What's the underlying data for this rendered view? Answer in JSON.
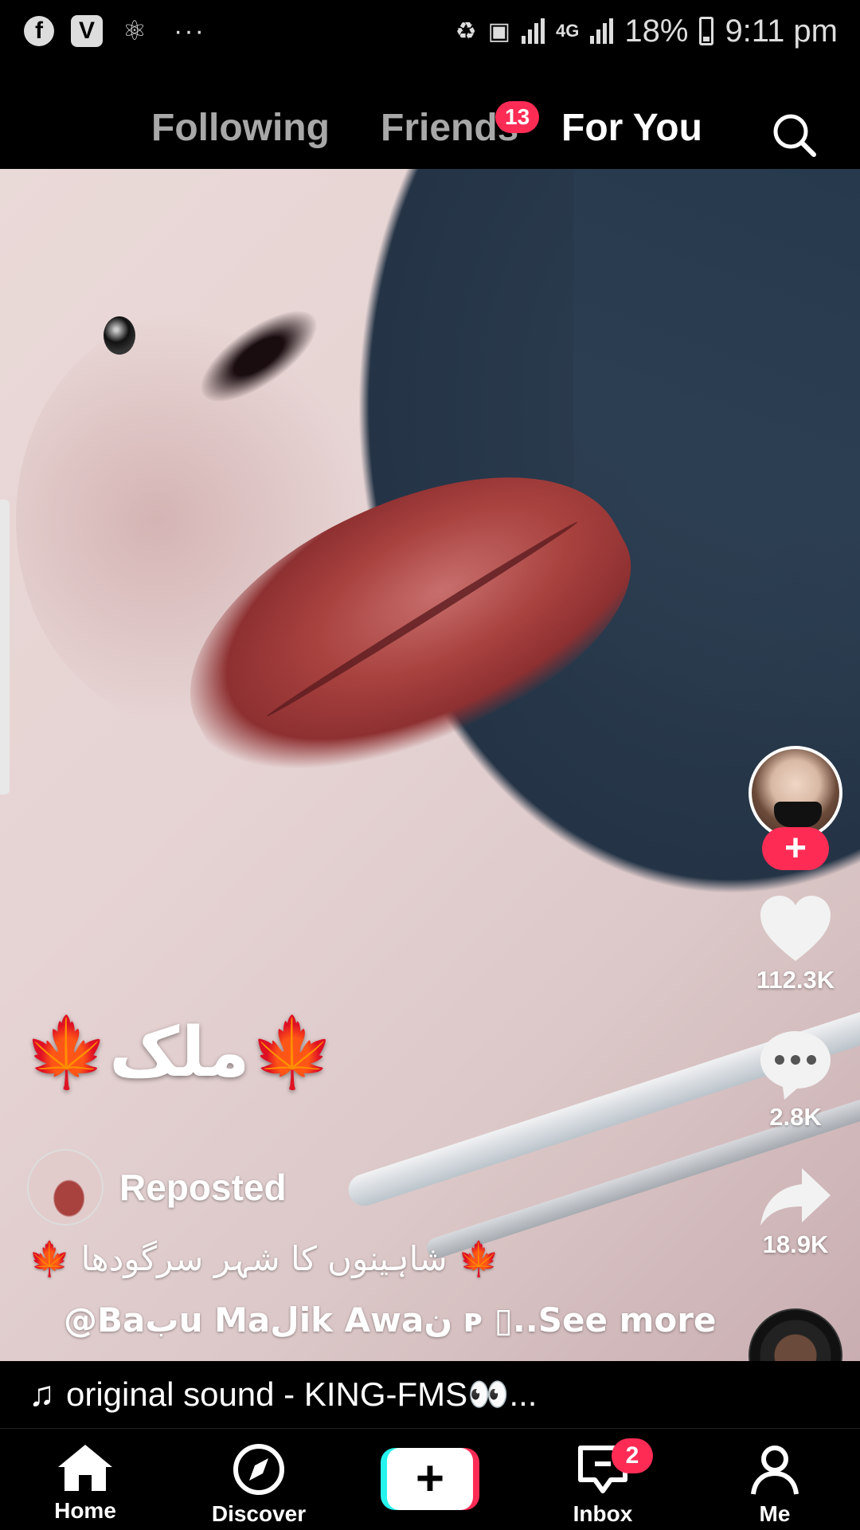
{
  "status_bar": {
    "app_icons": [
      "facebook-icon",
      "vpn-v-icon",
      "atom-icon"
    ],
    "more": "···",
    "network": "4G",
    "battery": "18%",
    "time": "9:11 pm"
  },
  "top_nav": {
    "tabs": [
      {
        "label": "Following",
        "active": false
      },
      {
        "label": "Friends",
        "active": false,
        "badge": "13"
      },
      {
        "label": "For You",
        "active": true
      }
    ],
    "search_icon": "search-icon"
  },
  "video": {
    "overlay_text": "🍁ملک🍁",
    "repost_label": "Reposted",
    "caption": "🍁 شاہینوں کا شہر سرگودھا 🍁",
    "mention": "@Baبu Maلik Awaن ᴘ ▯..",
    "see_more": "See more",
    "sound": "original sound - KING-FMS👀...",
    "sound_icon": "music-note-icon"
  },
  "actions": {
    "follow_label": "+",
    "likes": "112.3K",
    "comments": "2.8K",
    "shares": "18.9K"
  },
  "bottom_nav": {
    "items": [
      {
        "label": "Home",
        "icon": "home-icon",
        "active": true
      },
      {
        "label": "Discover",
        "icon": "compass-icon"
      },
      {
        "label": "",
        "icon": "create-plus-icon"
      },
      {
        "label": "Inbox",
        "icon": "inbox-icon",
        "badge": "2"
      },
      {
        "label": "Me",
        "icon": "profile-icon"
      }
    ],
    "create_label": "+"
  },
  "colors": {
    "accent": "#fe2c55",
    "cyan": "#25f4ee",
    "inactive_tab": "#a8a8a8"
  }
}
